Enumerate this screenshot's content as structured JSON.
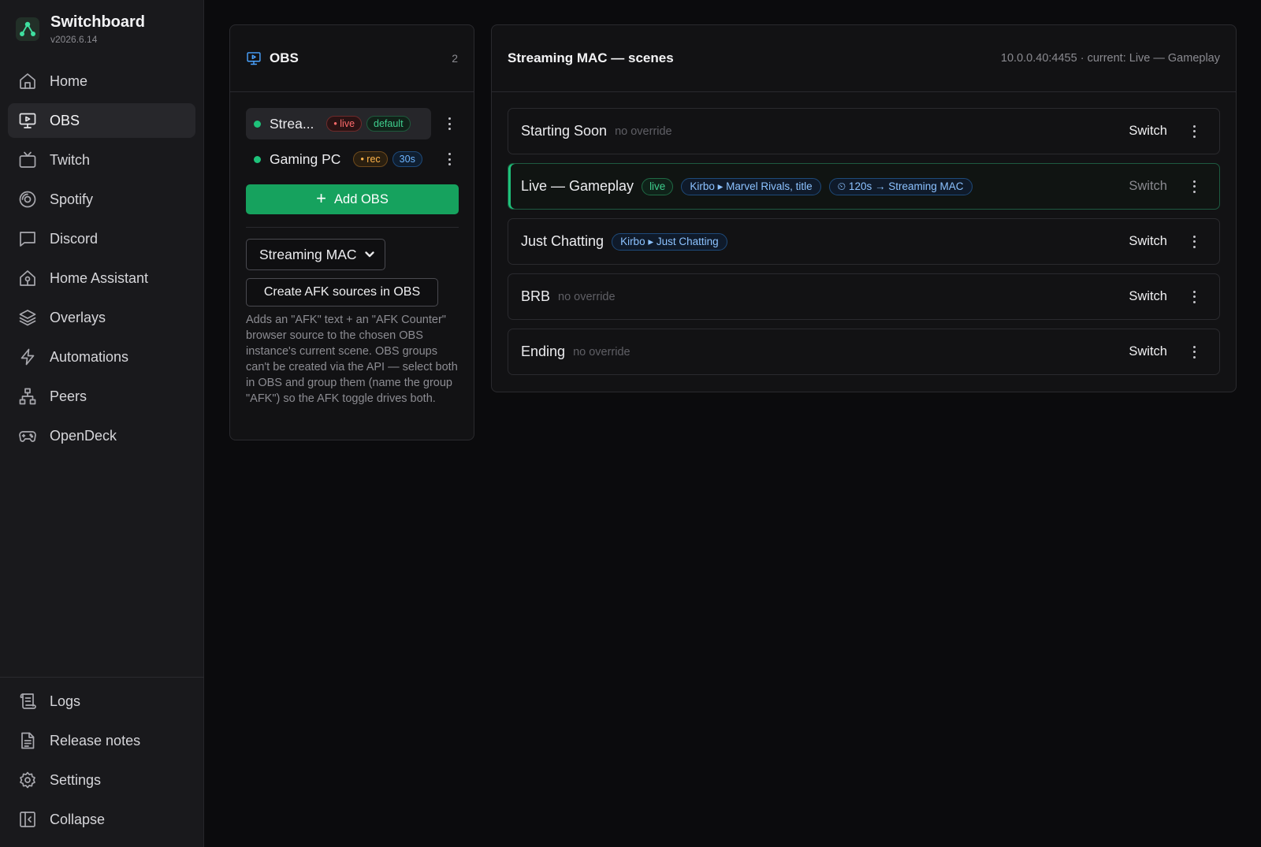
{
  "app": {
    "title": "Switchboard",
    "version": "v2026.6.14"
  },
  "nav": {
    "main": [
      {
        "label": "Home",
        "icon": "home-icon"
      },
      {
        "label": "OBS",
        "icon": "monitor-icon",
        "active": true
      },
      {
        "label": "Twitch",
        "icon": "tv-icon"
      },
      {
        "label": "Spotify",
        "icon": "spotify-icon"
      },
      {
        "label": "Discord",
        "icon": "chat-icon"
      },
      {
        "label": "Home Assistant",
        "icon": "home-assistant-icon"
      },
      {
        "label": "Overlays",
        "icon": "layers-icon"
      },
      {
        "label": "Automations",
        "icon": "lightning-icon"
      },
      {
        "label": "Peers",
        "icon": "network-icon"
      },
      {
        "label": "OpenDeck",
        "icon": "gamepad-icon"
      }
    ],
    "bottom": [
      {
        "label": "Logs",
        "icon": "scroll-icon"
      },
      {
        "label": "Release notes",
        "icon": "document-icon"
      },
      {
        "label": "Settings",
        "icon": "gear-icon"
      },
      {
        "label": "Collapse",
        "icon": "collapse-icon"
      }
    ]
  },
  "obs_panel": {
    "title": "OBS",
    "count": "2",
    "instances": [
      {
        "name": "Strea...",
        "badges": [
          "• live",
          "default"
        ],
        "selected": true
      },
      {
        "name": "Gaming PC",
        "badges": [
          "• rec",
          "30s"
        ],
        "selected": false
      }
    ],
    "add_label": "Add OBS",
    "select_value": "Streaming MAC",
    "afk_button": "Create AFK sources in OBS",
    "afk_description": "Adds an \"AFK\" text + an \"AFK Counter\" browser source to the chosen OBS instance's current scene. OBS groups can't be created via the API — select both in OBS and group them (name the group \"AFK\") so the AFK toggle drives both."
  },
  "scenes_panel": {
    "title": "Streaming MAC — scenes",
    "address": "10.0.0.40:4455 · current: Live — Gameplay",
    "switch_label": "Switch",
    "scenes": [
      {
        "name": "Starting Soon",
        "note": "no override",
        "pills": []
      },
      {
        "name": "Live — Gameplay",
        "note": "",
        "pills": [
          "live",
          "Kirbo ▸ Marvel Rivals, title",
          "⏲ 120s → Streaming MAC"
        ],
        "current": true
      },
      {
        "name": "Just Chatting",
        "note": "",
        "pills": [
          "Kirbo ▸ Just Chatting"
        ]
      },
      {
        "name": "BRB",
        "note": "no override",
        "pills": []
      },
      {
        "name": "Ending",
        "note": "no override",
        "pills": []
      }
    ]
  },
  "colors": {
    "accent_green": "#16a25e",
    "live_green": "#1ec27a",
    "link_blue": "#4aa3ff"
  }
}
